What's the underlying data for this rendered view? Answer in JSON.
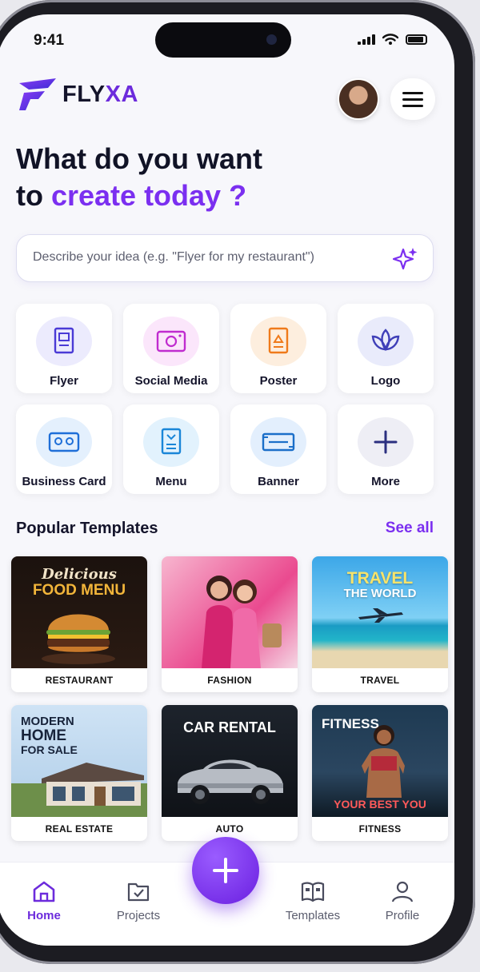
{
  "status": {
    "time": "9:41"
  },
  "brand": {
    "name_prefix": "FLY",
    "name_suffix": "XA"
  },
  "headline": {
    "line1": "What do you want",
    "line2_prefix": "to ",
    "line2_accent": "create today",
    "line2_suffix": " ?"
  },
  "search": {
    "placeholder": "Describe your idea (e.g. \"Flyer for my restaurant\")",
    "value": ""
  },
  "categories": [
    {
      "label": "Flyer",
      "icon": "flyer-icon",
      "color": "#4a3ad6",
      "bg": "#ecebfd"
    },
    {
      "label": "Social Media",
      "icon": "social-media-icon",
      "color": "#c02ccf",
      "bg": "#fbe6fb"
    },
    {
      "label": "Poster",
      "icon": "poster-icon",
      "color": "#ef7a1a",
      "bg": "#fdeede"
    },
    {
      "label": "Logo",
      "icon": "logo-lotus-icon",
      "color": "#3f3fb8",
      "bg": "#e9ebfb"
    },
    {
      "label": "Business Card",
      "icon": "business-card-icon",
      "color": "#1f6fd8",
      "bg": "#e4f0fd"
    },
    {
      "label": "Menu",
      "icon": "menu-card-icon",
      "color": "#1a86d8",
      "bg": "#e2f2fd"
    },
    {
      "label": "Banner",
      "icon": "banner-icon",
      "color": "#1b6fc9",
      "bg": "#e3effd"
    },
    {
      "label": "More",
      "icon": "plus-icon",
      "color": "#2b2f80",
      "bg": "#eeeef5"
    }
  ],
  "popular": {
    "title": "Popular Templates",
    "see_all": "See all"
  },
  "templates": [
    {
      "caption": "RESTAURANT",
      "line1": "Delicious",
      "line2": "FOOD MENU"
    },
    {
      "caption": "FASHION",
      "line1": "",
      "line2": ""
    },
    {
      "caption": "TRAVEL",
      "line1": "TRAVEL",
      "line2": "THE WORLD"
    },
    {
      "caption": "REAL ESTATE",
      "line1": "MODERN",
      "line2": "HOME",
      "line3": "FOR SALE"
    },
    {
      "caption": "AUTO",
      "line1": "CAR RENTAL",
      "line2": ""
    },
    {
      "caption": "FITNESS",
      "line1": "FITNESS",
      "line2": "YOUR BEST YOU"
    }
  ],
  "tabs": [
    {
      "label": "Home",
      "icon": "home-icon"
    },
    {
      "label": "Projects",
      "icon": "projects-icon"
    },
    {
      "label": "Templates",
      "icon": "templates-icon"
    },
    {
      "label": "Profile",
      "icon": "profile-icon"
    }
  ]
}
